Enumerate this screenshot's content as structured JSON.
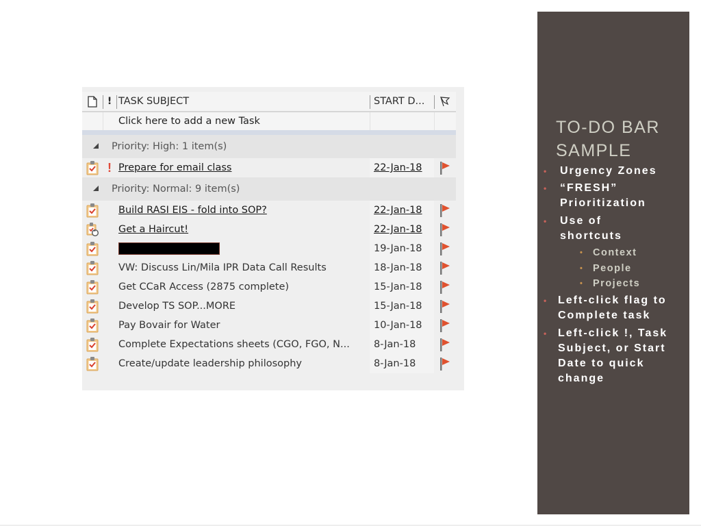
{
  "todo_bar": {
    "columns": {
      "icon": "task-type",
      "importance": "!",
      "subject": "TASK SUBJECT",
      "start_date": "START D...",
      "flag": "flag-status"
    },
    "new_task_placeholder": "Click here to add a new Task",
    "groups": [
      {
        "label": "Priority: High: 1 item(s)",
        "tasks": [
          {
            "subject": "Prepare for email class",
            "start_date": "22-Jan-18",
            "important": true,
            "underlined": true,
            "icon": "task-icon",
            "redacted": false
          }
        ]
      },
      {
        "label": "Priority: Normal: 9 item(s)",
        "tasks": [
          {
            "subject": "Build RASI EIS - fold into SOP?",
            "start_date": "22-Jan-18",
            "important": false,
            "underlined": true,
            "icon": "task-icon",
            "redacted": false
          },
          {
            "subject": "Get a Haircut!",
            "start_date": "22-Jan-18",
            "important": false,
            "underlined": true,
            "icon": "recurring-task-icon",
            "redacted": false
          },
          {
            "subject": "",
            "start_date": "19-Jan-18",
            "important": false,
            "underlined": false,
            "icon": "task-icon",
            "redacted": true
          },
          {
            "subject": "VW: Discuss Lin/Mila IPR Data Call Results",
            "start_date": "18-Jan-18",
            "important": false,
            "underlined": false,
            "icon": "task-icon",
            "redacted": false
          },
          {
            "subject": "Get CCaR Access (2875 complete)",
            "start_date": "15-Jan-18",
            "important": false,
            "underlined": false,
            "icon": "task-icon",
            "redacted": false
          },
          {
            "subject": "Develop TS SOP...MORE",
            "start_date": "15-Jan-18",
            "important": false,
            "underlined": false,
            "icon": "task-icon",
            "redacted": false
          },
          {
            "subject": "Pay Bovair for Water",
            "start_date": "10-Jan-18",
            "important": false,
            "underlined": false,
            "icon": "task-icon",
            "redacted": false
          },
          {
            "subject": "Complete Expectations sheets (CGO, FGO, N...",
            "start_date": "8-Jan-18",
            "important": false,
            "underlined": false,
            "icon": "task-icon",
            "redacted": false
          },
          {
            "subject": "Create/update leadership philosophy",
            "start_date": "8-Jan-18",
            "important": false,
            "underlined": false,
            "icon": "task-icon",
            "redacted": false
          }
        ]
      }
    ],
    "flag_color": "#e0522f",
    "importance_color": "#e04a3a"
  },
  "slide_panel": {
    "title_line1": "TO-DO BAR",
    "title_line2": "SAMPLE",
    "background": "#504845",
    "bullets": [
      {
        "lines": [
          "Urgency Zones"
        ]
      },
      {
        "lines": [
          "“FRESH”",
          "Prioritization"
        ]
      },
      {
        "lines": [
          "Use of",
          "shortcuts"
        ],
        "sub": [
          "Context",
          "People",
          "Projects"
        ]
      },
      {
        "lines": [
          "Left-click flag to",
          "Complete task"
        ]
      },
      {
        "lines": [
          "Left-click !, Task",
          "Subject, or Start",
          "Date to quick",
          "change"
        ]
      }
    ],
    "bullet_dot": "•"
  }
}
